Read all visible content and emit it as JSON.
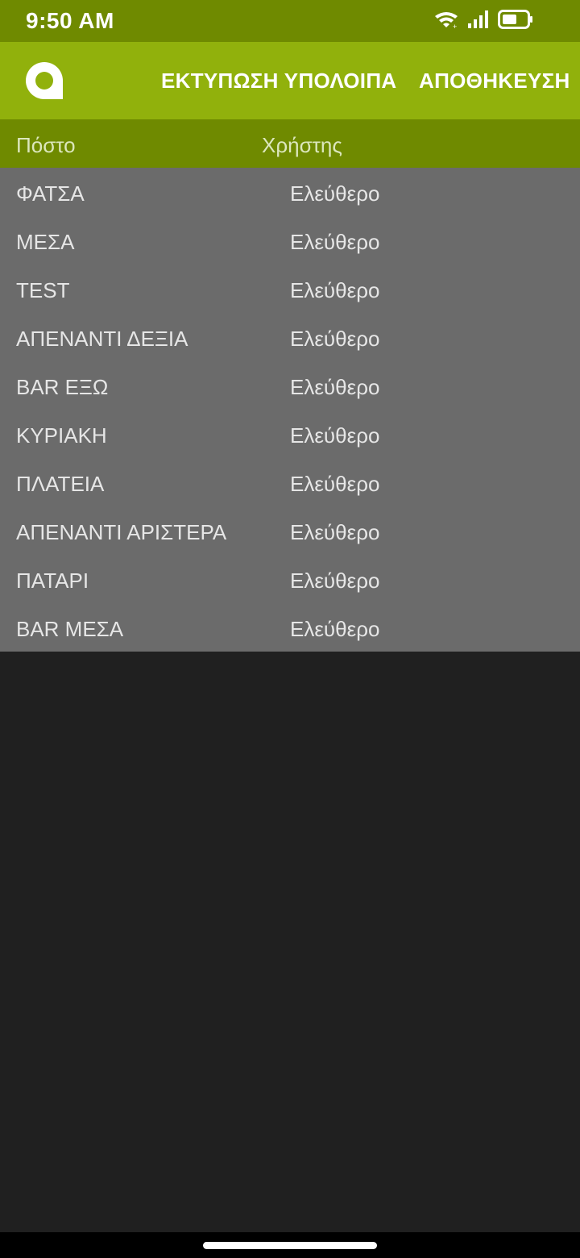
{
  "status_bar": {
    "time": "9:50 AM",
    "icons": [
      "wifi-icon",
      "signal-icon",
      "battery-icon"
    ],
    "battery_level": 0.6
  },
  "app_bar": {
    "logo_icon": "app-logo-icon",
    "print_label": "ΕΚΤΥΠΩΣΗ ΥΠΟΛΟΙΠΑ",
    "save_label": "ΑΠΟΘΗΚΕΥΣΗ"
  },
  "table": {
    "headers": [
      "Πόστο",
      "Χρήστης"
    ],
    "rows": [
      {
        "post": "ΦΑΤΣΑ",
        "user": "Ελεύθερο"
      },
      {
        "post": "ΜΕΣΑ",
        "user": "Ελεύθερο"
      },
      {
        "post": "TEST",
        "user": "Ελεύθερο"
      },
      {
        "post": "ΑΠΕΝΑΝΤΙ ΔΕΞΙΑ",
        "user": "Ελεύθερο"
      },
      {
        "post": "BAR ΕΞΩ",
        "user": "Ελεύθερο"
      },
      {
        "post": "ΚΥΡΙΑΚΗ",
        "user": "Ελεύθερο"
      },
      {
        "post": "ΠΛΑΤΕΙΑ",
        "user": "Ελεύθερο"
      },
      {
        "post": "ΑΠΕΝΑΝΤΙ ΑΡΙΣΤΕΡΑ",
        "user": "Ελεύθερο"
      },
      {
        "post": "ΠΑΤΑΡΙ",
        "user": "Ελεύθερο"
      },
      {
        "post": "BAR ΜΕΣΑ",
        "user": "Ελεύθερο"
      }
    ]
  },
  "colors": {
    "status_bar": "#6f8a00",
    "app_bar": "#91b10c",
    "header": "#6f8a00",
    "list_bg": "#6b6b6b",
    "page_bg": "#202020"
  }
}
